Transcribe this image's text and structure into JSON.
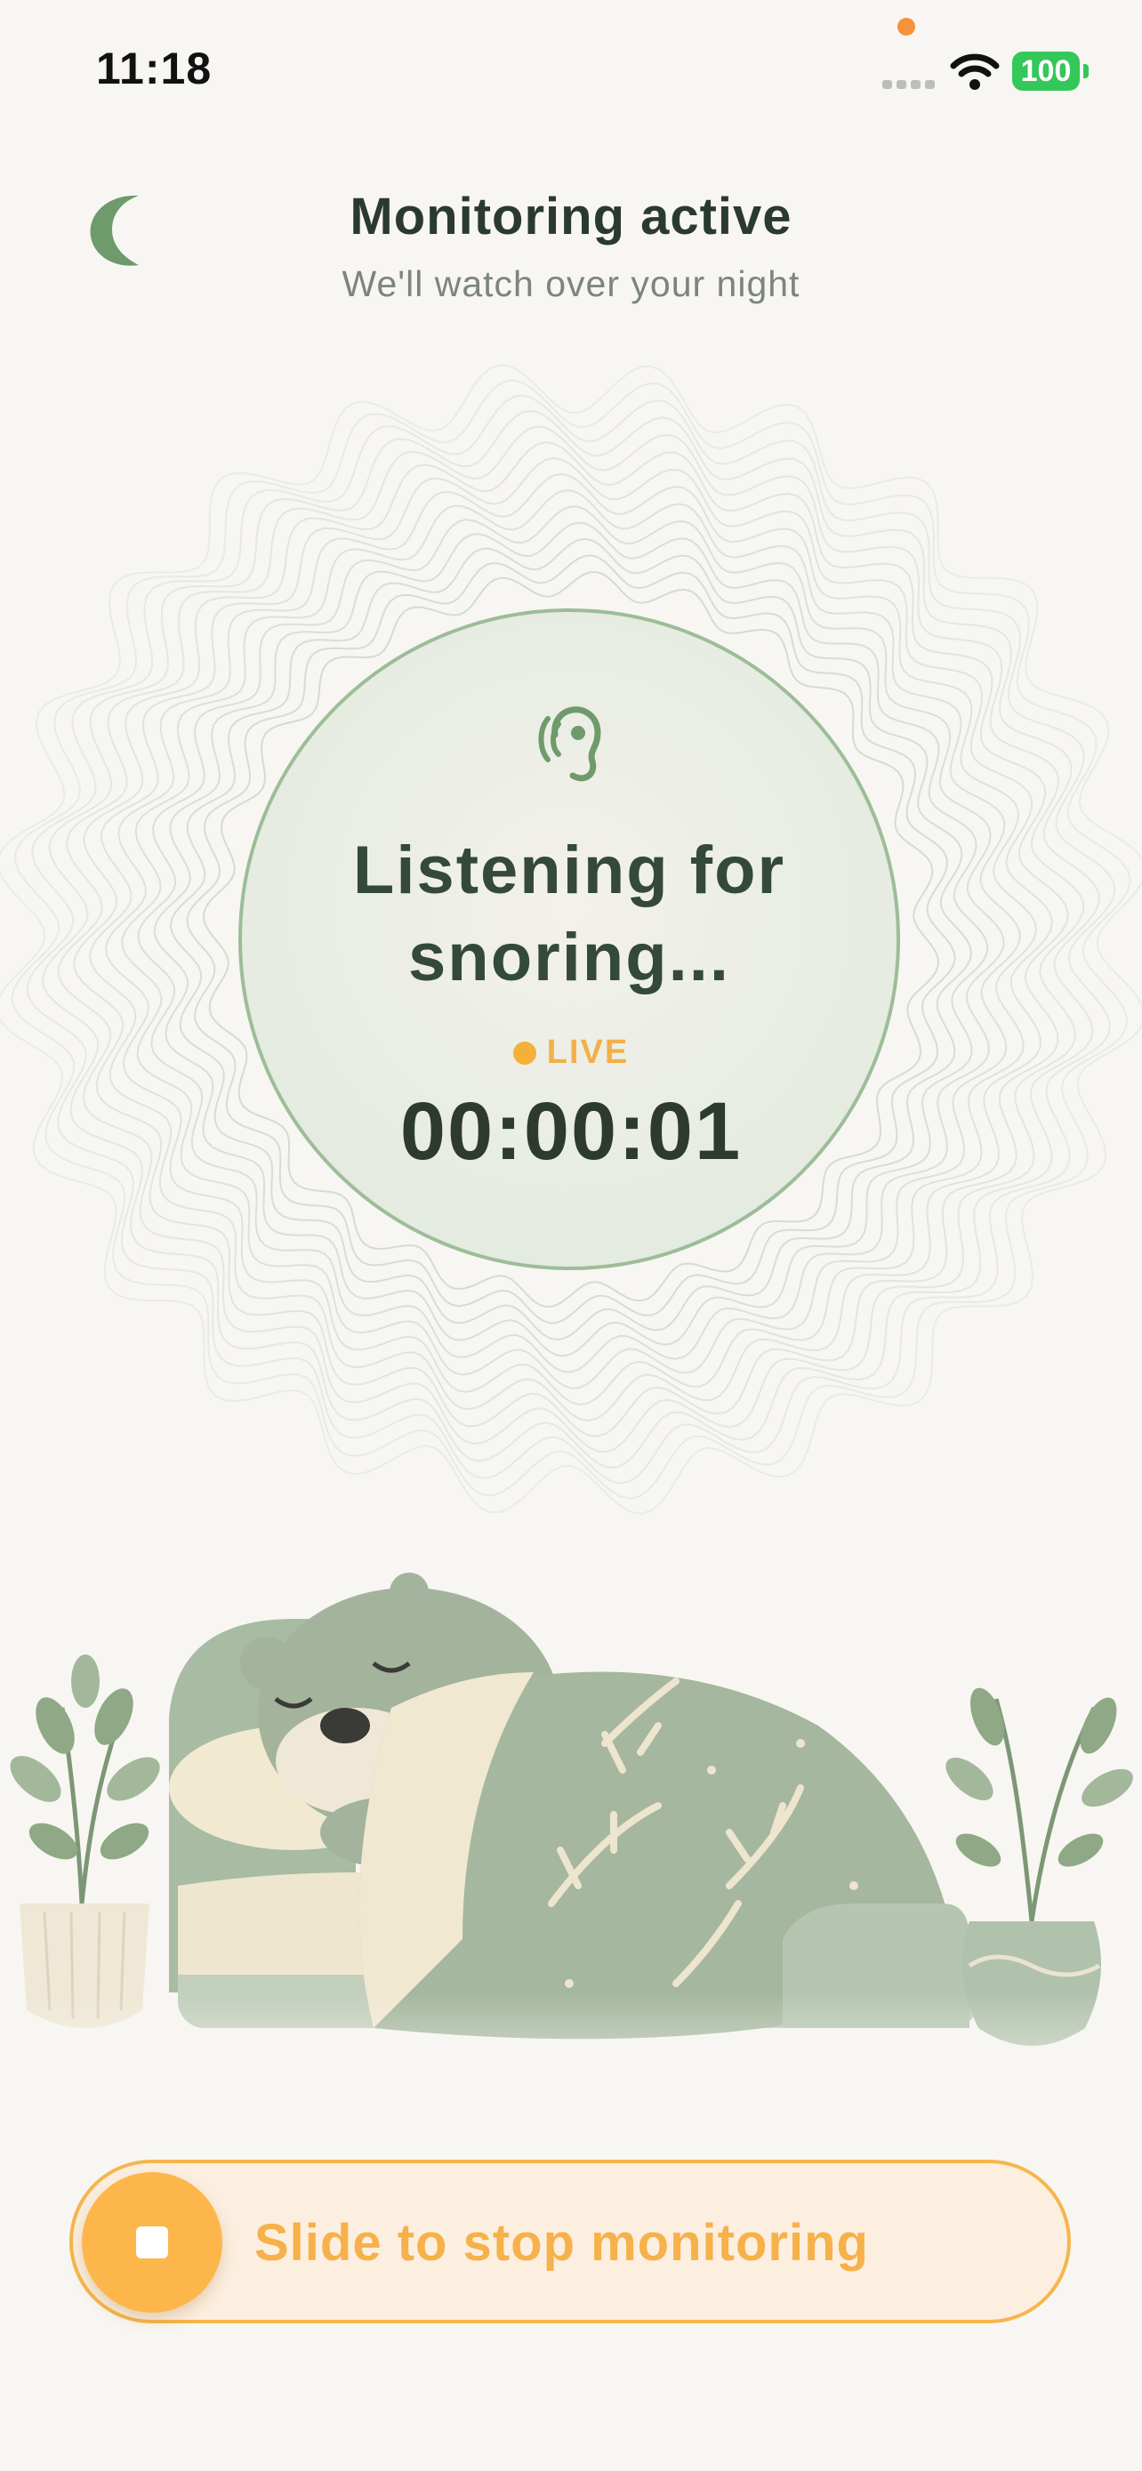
{
  "status_bar": {
    "time": "11:18",
    "battery": "100",
    "icons": [
      "cellular-signal-icon",
      "wifi-icon",
      "battery-icon"
    ]
  },
  "header": {
    "icon": "moon-icon",
    "title": "Monitoring active",
    "subtitle": "We'll watch over your night"
  },
  "listening": {
    "icon": "ear-icon",
    "status_line1": "Listening for",
    "status_line2": "snoring...",
    "live_label": "LIVE",
    "timer": "00:00:01"
  },
  "illustration": {
    "subject": "otter-sleeping-illustration"
  },
  "slider": {
    "label": "Slide to stop monitoring",
    "icon": "stop-icon"
  },
  "colors": {
    "background": "#f8f6f2",
    "accent_green": "#6f9a6c",
    "accent_orange": "#fdb64c",
    "text_dark": "#2b3a2e"
  }
}
